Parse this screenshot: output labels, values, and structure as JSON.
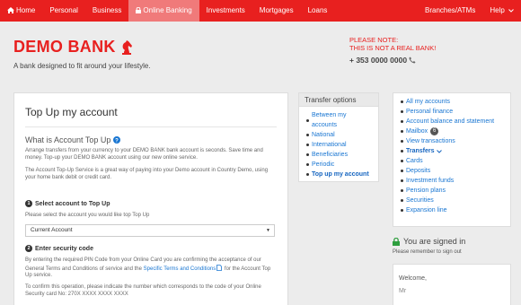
{
  "nav": {
    "home": "Home",
    "personal": "Personal",
    "business": "Business",
    "online_banking": "Online Banking",
    "investments": "Investments",
    "mortgages": "Mortgages",
    "loans": "Loans",
    "branches": "Branches/ATMs",
    "help": "Help"
  },
  "brand": {
    "name": "DEMO BANK",
    "tagline": "A bank designed to fit around your lifestyle.",
    "note_line1": "PLEASE NOTE:",
    "note_line2": "THIS IS NOT A REAL BANK!",
    "phone": "+ 353 0000 0000"
  },
  "main": {
    "title": "Top Up my account",
    "subtitle": "What is Account Top Up",
    "para1": "Arrange transfers from your currency to your DEMO BANK bank account is seconds. Save time and money. Top-up your DEMO BANK account using our new online service.",
    "para2": "The Account Top-Up Service is a great way of paying into your Demo account in Country Demo, using your home bank debit or credit card.",
    "step1_num": "1",
    "step1_label": "Select account to Top Up",
    "step1_hint": "Please select the account you would like top Top Up",
    "select_value": "Current Account",
    "step2_num": "2",
    "step2_label": "Enter security code",
    "step2_text_a": "By entering the required PIN Code from your Online Card you are confirming the acceptance of our General Terms and Conditions of service and the ",
    "step2_link": "Specific Terms and Conditions",
    "step2_text_b": " for the Account Top Up service.",
    "step2_text2": "To confirm this operation, please indicate the number which corresponds to the code of your Online Security card No: 270X XXXX XXXX XXXX"
  },
  "transfer_panel": {
    "heading": "Transfer options",
    "items": [
      "Between my accounts",
      "National",
      "International",
      "Beneficiaries",
      "Periodic",
      "Top up my account"
    ]
  },
  "account_panel": {
    "items": [
      "All my accounts",
      "Personal finance",
      "Account balance and statement",
      "Mailbox",
      "View transactions",
      "Transfers",
      "Cards",
      "Deposits",
      "Investment funds",
      "Pension plans",
      "Securities",
      "Expansion line"
    ],
    "mailbox_count": "6"
  },
  "signin": {
    "status": "You are signed in",
    "reminder": "Please remember to sign out",
    "welcome": "Welcome,",
    "name": "Mr"
  }
}
